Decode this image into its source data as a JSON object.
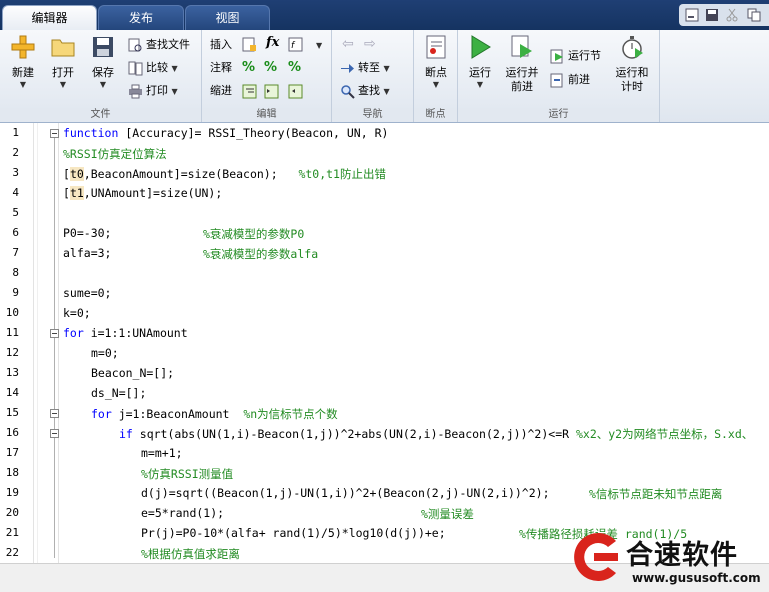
{
  "tabs": [
    {
      "label": "编辑器"
    },
    {
      "label": "发布"
    },
    {
      "label": "视图"
    }
  ],
  "ribbon": {
    "file": {
      "new": "新建",
      "open": "打开",
      "save": "保存",
      "find_file": "查找文件",
      "compare": "比较",
      "print": "打印",
      "group": "文件"
    },
    "edit": {
      "insert": "插入",
      "comment": "注释",
      "indent": "缩进",
      "group": "编辑"
    },
    "nav": {
      "goto": "转至",
      "find": "查找",
      "group": "导航"
    },
    "breakpoint": {
      "label": "断点",
      "group": "断点"
    },
    "run": {
      "run": "运行",
      "run_advance": "运行并\n前进",
      "run_section": "运行节",
      "advance": "前进",
      "run_time": "运行和\n计时",
      "group": "运行"
    }
  },
  "editor": {
    "lines": [
      {
        "n": "1",
        "fold": true
      },
      {
        "n": "2"
      },
      {
        "n": "3"
      },
      {
        "n": "4"
      },
      {
        "n": "5"
      },
      {
        "n": "6"
      },
      {
        "n": "7"
      },
      {
        "n": "8"
      },
      {
        "n": "9"
      },
      {
        "n": "10"
      },
      {
        "n": "11",
        "fold": true
      },
      {
        "n": "12"
      },
      {
        "n": "13"
      },
      {
        "n": "14"
      },
      {
        "n": "15",
        "fold": true
      },
      {
        "n": "16",
        "fold": true
      },
      {
        "n": "17"
      },
      {
        "n": "18"
      },
      {
        "n": "19"
      },
      {
        "n": "20"
      },
      {
        "n": "21"
      },
      {
        "n": "22"
      }
    ],
    "code": {
      "l1_kw": "function",
      "l1_rest": " [Accuracy]= RSSI_Theory(Beacon, UN, R)",
      "l2": "%RSSI仿真定位算法",
      "l3_a": "[",
      "l3_b": "t0",
      "l3_c": ",BeaconAmount]=size(Beacon);",
      "l3_cm": "   %t0,t1防止出错",
      "l4_a": "[",
      "l4_b": "t1",
      "l4_c": ",UNAmount]=size(UN);",
      "l6": "P0=-30;",
      "l6_cm": "%衰减模型的参数P0",
      "l7": "alfa=3;",
      "l7_cm": "%衰减模型的参数alfa",
      "l9": "sume=0;",
      "l10": "k=0;",
      "l11_kw": "for",
      "l11_rest": " i=1:1:UNAmount",
      "l12": "m=0;",
      "l13": "Beacon_N=[];",
      "l14": "ds_N=[];",
      "l15_kw": "for",
      "l15_rest": " j=1:BeaconAmount",
      "l15_cm": "  %n为信标节点个数",
      "l16_kw": "if",
      "l16_rest": " sqrt(abs(UN(1,i)-Beacon(1,j))^2+abs(UN(2,i)-Beacon(2,j))^2)<=R",
      "l16_cm": " %x2、y2为网络节点坐标，S.xd、",
      "l17": "m=m+1;",
      "l18": "%仿真RSSI测量值",
      "l19": "d(j)=sqrt((Beacon(1,j)-UN(1,i))^2+(Beacon(2,j)-UN(2,i))^2);",
      "l19_cm": "%信标节点距未知节点距离",
      "l20": "e=5*rand(1);",
      "l20_cm": "%测量误差",
      "l21": "Pr(j)=P0-10*(alfa+ rand(1)/5)*log10(d(j))+e;",
      "l21_cm": "%传播路径损耗误差 rand(1)/5",
      "l22": "%根据仿真值求距离"
    }
  },
  "watermark": {
    "name": "合速软件",
    "url": "www.gususoft.com"
  },
  "colors": {
    "keyword": "#0000ff",
    "comment": "#228b22",
    "tabbar": "#1f3f74",
    "logo_red": "#d9241c"
  }
}
